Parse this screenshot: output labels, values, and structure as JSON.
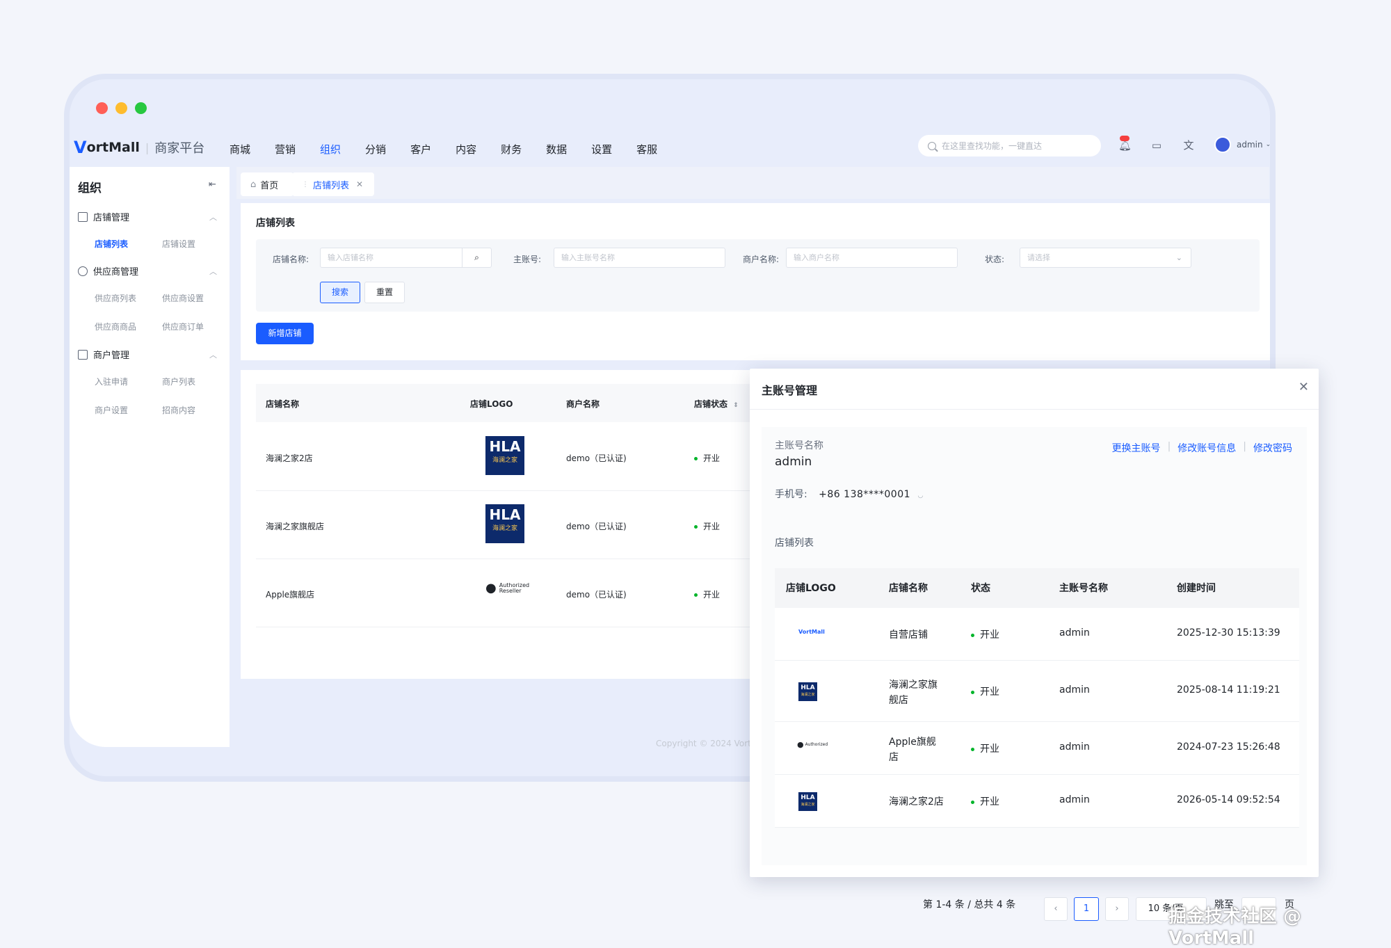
{
  "topbar": {
    "logo_mark": "V",
    "brand": "ortMall",
    "platform": "商家平台",
    "nav": [
      "商城",
      "营销",
      "组织",
      "分销",
      "客户",
      "内容",
      "财务",
      "数据",
      "设置",
      "客服"
    ],
    "active_nav": "组织",
    "search_placeholder": "在这里查找功能，一键直达",
    "user": "admin"
  },
  "sidebar": {
    "title": "组织",
    "groups": [
      {
        "label": "店铺管理",
        "items": [
          "店铺列表",
          "店铺设置"
        ]
      },
      {
        "label": "供应商管理",
        "items": [
          "供应商列表",
          "供应商设置",
          "供应商商品",
          "供应商订单"
        ]
      },
      {
        "label": "商户管理",
        "items": [
          "入驻申请",
          "商户列表",
          "商户设置",
          "招商内容"
        ]
      }
    ],
    "active_item": "店铺列表"
  },
  "tabs": {
    "home": "首页",
    "current": "店铺列表"
  },
  "filter": {
    "title": "店铺列表",
    "store_name_label": "店铺名称:",
    "store_name_placeholder": "输入店铺名称",
    "account_label": "主账号:",
    "account_placeholder": "输入主账号名称",
    "merchant_label": "商户名称:",
    "merchant_placeholder": "输入商户名称",
    "status_label": "状态:",
    "status_placeholder": "请选择",
    "search_btn": "搜索",
    "reset_btn": "重置",
    "add_btn": "新增店铺"
  },
  "store_table": {
    "headers": [
      "店铺名称",
      "店铺LOGO",
      "商户名称",
      "店铺状态"
    ],
    "rows": [
      {
        "name": "海澜之家2店",
        "logo": "hla",
        "merchant": "demo（已认证)",
        "status": "开业"
      },
      {
        "name": "海澜之家旗舰店",
        "logo": "hla",
        "merchant": "demo（已认证)",
        "status": "开业"
      },
      {
        "name": "Apple旗舰店",
        "logo": "apple",
        "merchant": "demo（已认证)",
        "status": "开业"
      }
    ]
  },
  "logos": {
    "hla_text": "HLA",
    "hla_sub": "海澜之家",
    "apple_line1": "Authorized",
    "apple_line2": "Reseller",
    "vortmall_mini": "VortMall"
  },
  "copyright": "Copyright © 2024 Vort",
  "modal": {
    "title": "主账号管理",
    "account_label": "主账号名称",
    "account_name": "admin",
    "links": [
      "更换主账号",
      "修改账号信息",
      "修改密码"
    ],
    "phone_label": "手机号:",
    "phone_value": "+86 138****0001",
    "store_list_title": "店铺列表",
    "headers": [
      "店铺LOGO",
      "店铺名称",
      "状态",
      "主账号名称",
      "创建时间"
    ],
    "rows": [
      {
        "logo": "vortmall",
        "name": "自营店铺",
        "status": "开业",
        "account": "admin",
        "created": "2025-12-30 15:13:39"
      },
      {
        "logo": "hla",
        "name": "海澜之家旗舰店",
        "status": "开业",
        "account": "admin",
        "created": "2025-08-14 11:19:21"
      },
      {
        "logo": "apple",
        "name": "Apple旗舰店",
        "status": "开业",
        "account": "admin",
        "created": "2024-07-23 15:26:48"
      },
      {
        "logo": "hla",
        "name": "海澜之家2店",
        "status": "开业",
        "account": "admin",
        "created": "2026-05-14 09:52:54"
      }
    ],
    "pagination": {
      "summary": "第 1-4 条 / 总共 4 条",
      "current_page": "1",
      "page_size": "10 条/页",
      "jump_label": "跳至",
      "page_suffix": "页"
    }
  },
  "watermark": "掘金技术社区 @ VortMall"
}
